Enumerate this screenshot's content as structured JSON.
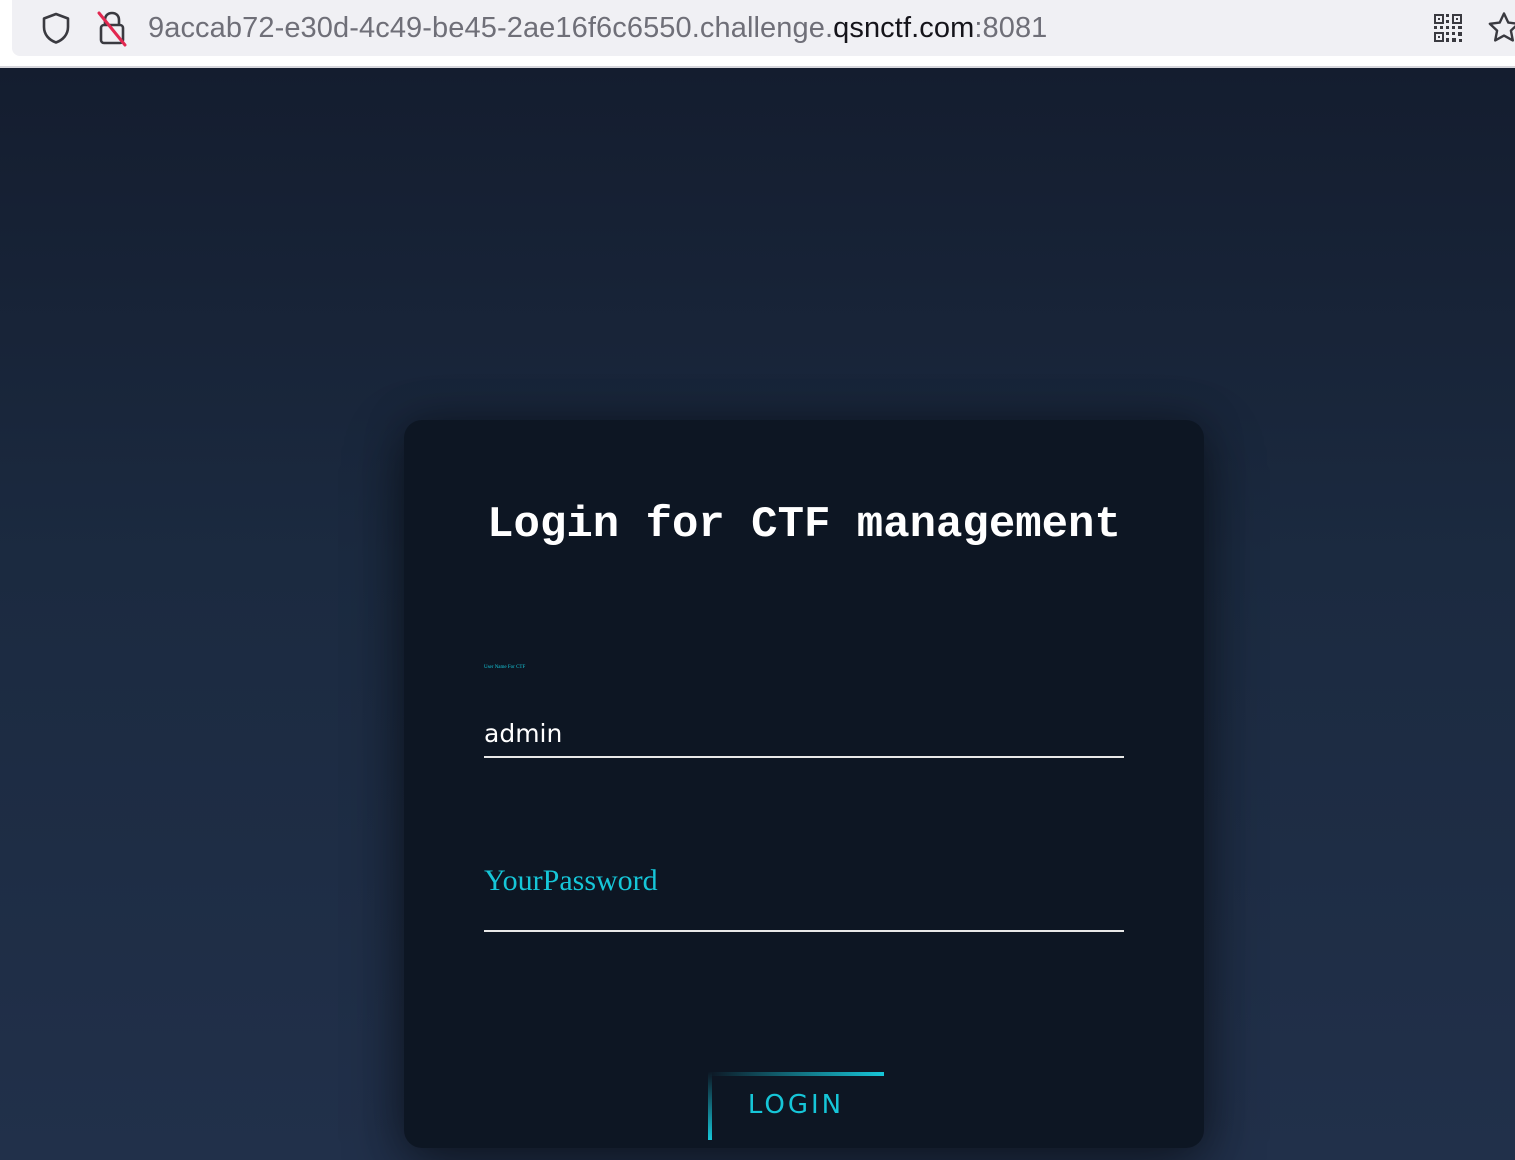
{
  "browser": {
    "url_prefix": "9accab72-e30d-4c49-be45-2ae16f6c6550.challenge.",
    "url_domain": "qsnctf.com",
    "url_suffix": ":8081",
    "icons": [
      "shield-icon",
      "insecure-lock-icon",
      "qr-code-icon",
      "bookmark-star-icon"
    ]
  },
  "login": {
    "title": "Login for CTF management",
    "username_label": "User Name For CTF",
    "username_value": "admin",
    "password_placeholder": "YourPassword",
    "button_label": "LOGIN"
  },
  "colors": {
    "accent": "#16c6d8",
    "card_background": "#0d1623",
    "page_background_top": "#141d2f",
    "page_background_bottom": "#21304a"
  }
}
